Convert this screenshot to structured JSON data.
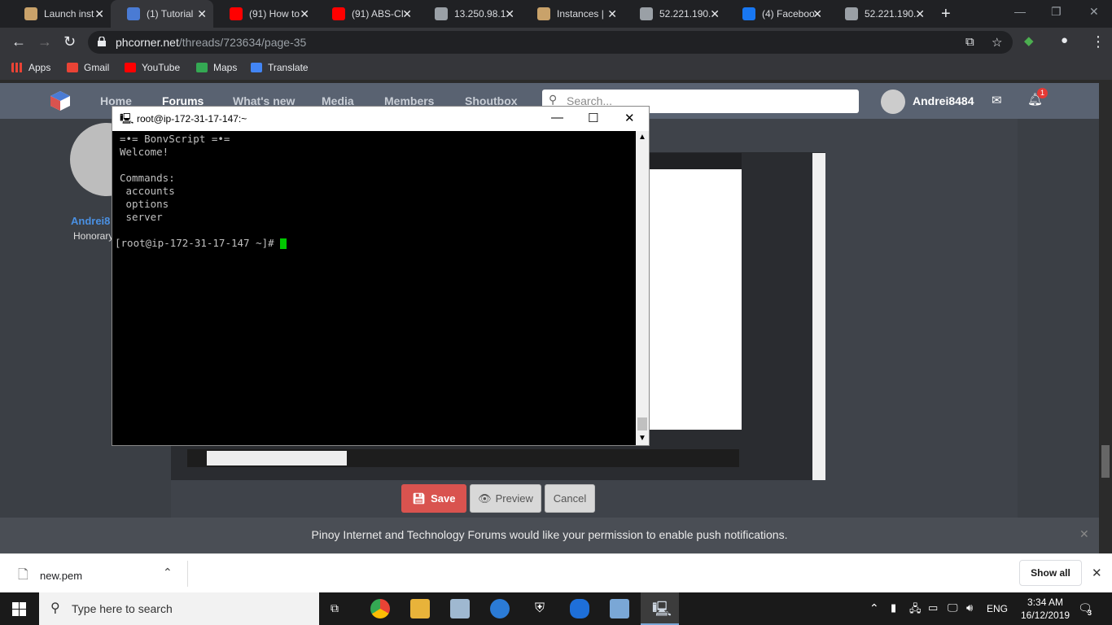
{
  "browser": {
    "tabs": [
      {
        "title": "Launch inst",
        "icon": "box-icon",
        "color": "#c9a26a"
      },
      {
        "title": "(1) Tutorial",
        "icon": "phcorner-icon",
        "color": "#4a7bd4"
      },
      {
        "title": "(91) How to",
        "icon": "youtube-icon",
        "color": "#ff0000"
      },
      {
        "title": "(91) ABS-CI",
        "icon": "youtube-icon",
        "color": "#ff0000"
      },
      {
        "title": "13.250.98.1",
        "icon": "globe-icon",
        "color": "#9aa0a6"
      },
      {
        "title": "Instances |",
        "icon": "box-icon",
        "color": "#c9a26a"
      },
      {
        "title": "52.221.190.",
        "icon": "globe-icon",
        "color": "#9aa0a6"
      },
      {
        "title": "(4) Faceboo",
        "icon": "facebook-icon",
        "color": "#1877f2"
      },
      {
        "title": "52.221.190.",
        "icon": "globe-icon",
        "color": "#9aa0a6"
      }
    ],
    "url_host": "phcorner.net",
    "url_path": "/threads/723634/page-35",
    "bookmarks": [
      "Apps",
      "Gmail",
      "YouTube",
      "Maps",
      "Translate"
    ]
  },
  "site": {
    "nav": [
      "Home",
      "Forums",
      "What's new",
      "Media",
      "Members",
      "Shoutbox"
    ],
    "search_placeholder": "Search...",
    "username": "Andrei8484",
    "notification_count": "1",
    "post_author": "Andrei8",
    "post_author_title": "Honorary",
    "buttons": {
      "save": "Save",
      "preview": "Preview",
      "cancel": "Cancel"
    },
    "push_notice": "Pinoy Internet and Technology Forums would like your permission to enable push notifications."
  },
  "putty": {
    "title": "root@ip-172-31-17-147:~",
    "lines": [
      "=•= BonvScript =•=",
      "Welcome!",
      "",
      "Commands:",
      " accounts",
      " options",
      " server",
      ""
    ],
    "prompt": "[root@ip-172-31-17-147 ~]# "
  },
  "downloads": {
    "file": "new.pem",
    "show_all": "Show all"
  },
  "taskbar": {
    "search_placeholder": "Type here to search",
    "lang": "ENG",
    "time": "3:34 AM",
    "date": "16/12/2019",
    "notification_count": "3"
  }
}
